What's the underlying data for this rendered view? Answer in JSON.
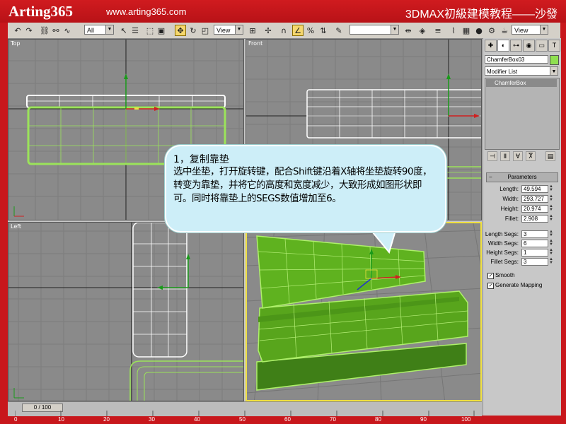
{
  "header": {
    "brand": "Arting365",
    "site": "www.arting365.com",
    "course": "3DMAX初級建模教程——沙發"
  },
  "toolbar": {
    "selection_filter": "All",
    "reference_coord": "View",
    "named_selection": "",
    "render_view": "View",
    "buttons": [
      "undo-icon",
      "redo-icon",
      "link-icon",
      "unlink-icon",
      "bind-spacewarp-icon",
      "select-icon",
      "select-by-name-icon",
      "rect-region-icon",
      "window-crossing-icon",
      "move-icon",
      "rotate-icon",
      "scale-icon",
      "pivot-icon",
      "snap-2d-icon",
      "angle-snap-icon",
      "percent-snap-icon",
      "spinner-snap-icon",
      "mirror-icon",
      "align-icon",
      "layer-icon",
      "curve-editor-icon",
      "schematic-icon",
      "material-editor-icon",
      "render-setup-icon",
      "quick-render-icon"
    ]
  },
  "viewports": {
    "top": "Top",
    "front": "Front",
    "left": "Left",
    "perspective": ""
  },
  "panel": {
    "object_name": "ChamferBox03",
    "object_color": "#8fe050",
    "modifier_list": "Modifier List",
    "stack_item": "ChamferBox",
    "rollout_title": "Parameters",
    "params": [
      {
        "label": "Length:",
        "value": "49.594"
      },
      {
        "label": "Width:",
        "value": "293.727"
      },
      {
        "label": "Height:",
        "value": "20.974"
      },
      {
        "label": "Fillet:",
        "value": "2.908"
      }
    ],
    "segs": [
      {
        "label": "Length Segs:",
        "value": "3"
      },
      {
        "label": "Width Segs:",
        "value": "6"
      },
      {
        "label": "Height Segs:",
        "value": "1"
      },
      {
        "label": "Fillet Segs:",
        "value": "3"
      }
    ],
    "checks": [
      {
        "label": "Smooth",
        "checked": true
      },
      {
        "label": "Generate Mapping",
        "checked": true
      }
    ]
  },
  "timeline": {
    "slider": "0 / 100",
    "ruler_labels": [
      "0",
      "10",
      "20",
      "30",
      "40",
      "50",
      "60",
      "70",
      "80",
      "90",
      "100"
    ]
  },
  "callout": {
    "title": "1，复制靠垫",
    "body": "选中坐垫，打开旋转键，配合Shift键沿着X轴将坐垫旋转90度，转变为靠垫，并将它的高度和宽度减少，大致形成如图形状即可。同时将靠垫上的SEGS数值增加至6。"
  },
  "colors": {
    "frame_red": "#c8171c",
    "object_green": "#8fe050",
    "active_viewport": "#f0e040",
    "callout_fill": "#cdeef8"
  }
}
